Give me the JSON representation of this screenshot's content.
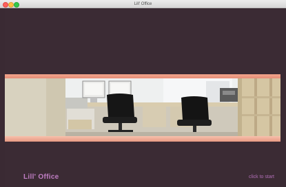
{
  "window": {
    "title": "Lill' Office"
  },
  "app": {
    "title": "Lill' Office",
    "start_label": "click to start"
  },
  "scene": {
    "subject": "office with two computer monitors and two black office chairs"
  },
  "colors": {
    "background": "#3b2b34",
    "stripe": "#f2a58c",
    "title_text": "#c07ec4"
  }
}
